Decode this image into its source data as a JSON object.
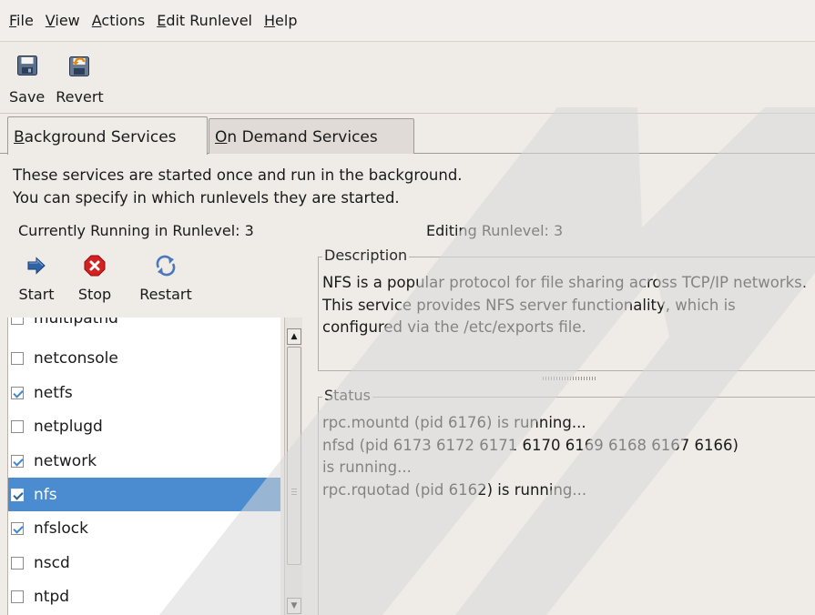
{
  "menubar": {
    "items": [
      {
        "label": "File",
        "mnemonic": "F",
        "rest": "ile"
      },
      {
        "label": "View",
        "mnemonic": "V",
        "rest": "iew"
      },
      {
        "label": "Actions",
        "mnemonic": "A",
        "rest": "ctions"
      },
      {
        "label": "Edit Runlevel",
        "mnemonic": "E",
        "rest": "dit Runlevel"
      },
      {
        "label": "Help",
        "mnemonic": "H",
        "rest": "elp"
      }
    ]
  },
  "toolbar": {
    "save_label": "Save",
    "revert_label": "Revert",
    "save_icon": "floppy-disk-icon",
    "revert_icon": "revert-disk-icon"
  },
  "tabs": [
    {
      "label": "Background Services",
      "mnemonic": "B",
      "rest": "ackground Services",
      "active": true
    },
    {
      "label": "On Demand Services",
      "mnemonic": "O",
      "rest": "n Demand Services",
      "active": false
    }
  ],
  "intro": {
    "line1": "These services are started once and run in the background.",
    "line2": "You can specify in which runlevels they are started."
  },
  "runlevel": {
    "running_text": "Currently Running in Runlevel: 3",
    "editing_text": "Editing Runlevel: 3"
  },
  "service_toolbar": {
    "start_label": "Start",
    "stop_label": "Stop",
    "restart_label": "Restart"
  },
  "services": [
    {
      "name": "multipathd",
      "checked": false,
      "selected": false
    },
    {
      "name": "netconsole",
      "checked": false,
      "selected": false
    },
    {
      "name": "netfs",
      "checked": true,
      "selected": false
    },
    {
      "name": "netplugd",
      "checked": false,
      "selected": false
    },
    {
      "name": "network",
      "checked": true,
      "selected": false
    },
    {
      "name": "nfs",
      "checked": true,
      "selected": true
    },
    {
      "name": "nfslock",
      "checked": true,
      "selected": false
    },
    {
      "name": "nscd",
      "checked": false,
      "selected": false
    },
    {
      "name": "ntpd",
      "checked": false,
      "selected": false
    }
  ],
  "description": {
    "legend": "Description",
    "text": "NFS is a popular protocol for file sharing across TCP/IP networks. This service provides NFS server functionality, which is configured via the /etc/exports file."
  },
  "status": {
    "legend": "Status",
    "lines": [
      "rpc.mountd (pid 6176) is running...",
      "nfsd (pid 6173 6172 6171 6170 6169 6168 6167 6166)",
      "is running...",
      "rpc.rquotad (pid 6162) is running..."
    ]
  },
  "colors": {
    "selection": "#4a8ccf",
    "check": "#3d86d4",
    "window_bg": "#efebe7"
  }
}
